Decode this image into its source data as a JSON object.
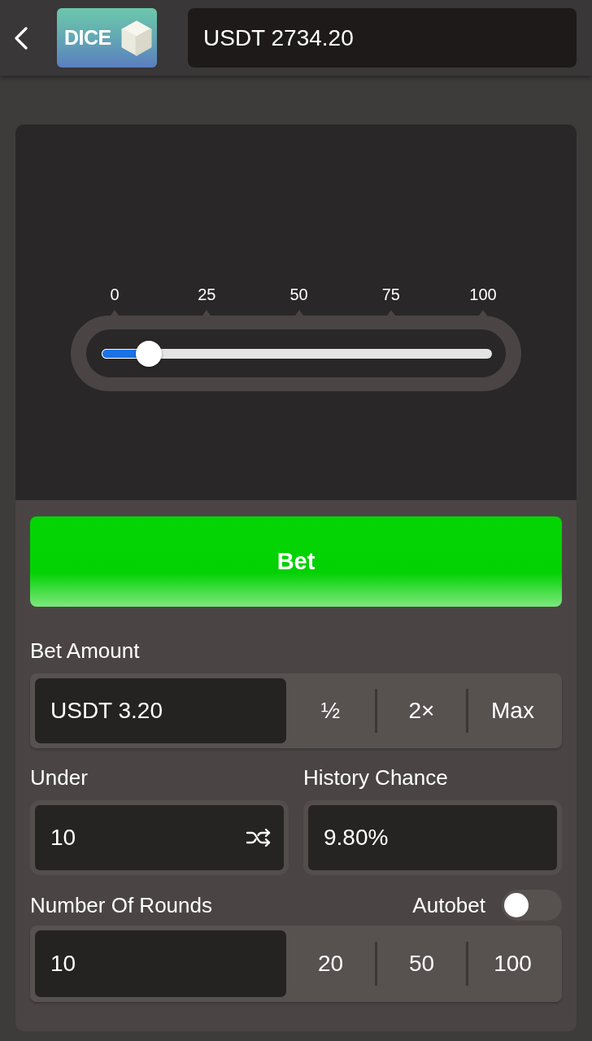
{
  "header": {
    "logo_text": "DICE",
    "balance": "USDT 2734.20"
  },
  "slider": {
    "ticks": [
      "0",
      "25",
      "50",
      "75",
      "100"
    ],
    "level": 0.12
  },
  "bet_button": {
    "label": "Bet"
  },
  "bet_amount": {
    "label": "Bet Amount",
    "value": "USDT 3.20",
    "options": [
      "½",
      "2×",
      "Max"
    ]
  },
  "under": {
    "label": "Under",
    "value": "10"
  },
  "history_chance": {
    "label": "History Chance",
    "value": "9.80%"
  },
  "rounds": {
    "label": "Number Of Rounds",
    "value": "10",
    "options": [
      "20",
      "50",
      "100"
    ]
  },
  "autobet": {
    "label": "Autobet",
    "on": false
  }
}
